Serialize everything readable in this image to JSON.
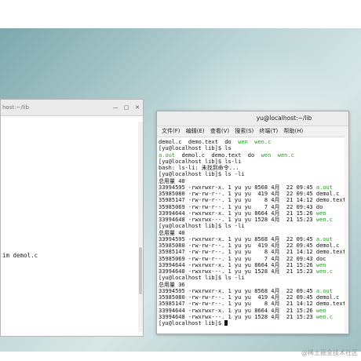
{
  "left_window": {
    "title": "host:~/lib",
    "visible_text": "im demol.c"
  },
  "terminal": {
    "title": "yu@localhost:~/lib",
    "menu": [
      "文件(F)",
      "编辑(E)",
      "查看(V)",
      "搜索(S)",
      "终端(T)",
      "帮助(H)"
    ],
    "lines": [
      [
        {
          "t": "demol.c  demo.text  do  "
        },
        {
          "t": "wen  wen.c",
          "c": "g"
        }
      ],
      [
        {
          "t": "[yu@localhost lib]$ ls"
        }
      ],
      [
        {
          "t": "a.out",
          "c": "g"
        },
        {
          "t": "  demol.c  demo.text  do  "
        },
        {
          "t": "wen  wen.c",
          "c": "g"
        }
      ],
      [
        {
          "t": "[yu@localhost lib]$ ls-li"
        }
      ],
      [
        {
          "t": "bash: ls-li: 未找到命令..."
        }
      ],
      [
        {
          "t": "[yu@localhost lib]$ ls -li"
        }
      ],
      [
        {
          "t": "总用量 40"
        }
      ],
      [
        {
          "t": "33994595 -rwxrwxr-x. 1 yu yu 8568 4月  22 09:45 "
        },
        {
          "t": "a.out",
          "c": "g"
        }
      ],
      [
        {
          "t": "35985080 -rw-rw-r--. 1 yu yu  419 4月  22 09:45 demol.c"
        }
      ],
      [
        {
          "t": "35985147 -rw-rw-r--. 1 yu yu    8 4月  21 14:12 demo.text"
        }
      ],
      [
        {
          "t": "35985069 -rw-rw-r--. 1 yu yu    7 4月  22 09:43 do"
        }
      ],
      [
        {
          "t": "33994644 -rwxrwxr-x. 1 yu yu 8664 4月  21 15:26 "
        },
        {
          "t": "wen",
          "c": "g"
        }
      ],
      [
        {
          "t": "33994648 -rwxrwx---. 1 yu yu 1528 4月  21 15:23 "
        },
        {
          "t": "wen.c",
          "c": "g"
        }
      ],
      [
        {
          "t": "[yu@localhost lib]$ ls -li"
        }
      ],
      [
        {
          "t": "总用量 40"
        }
      ],
      [
        {
          "t": "33994595 -rwxrwxr-x. 1 yu yu 8568 4月  22 09:45 "
        },
        {
          "t": "a.out",
          "c": "g"
        }
      ],
      [
        {
          "t": "35985080 -rw-rw-r--. 1 yu yu  419 4月  22 09:45 demol.c"
        }
      ],
      [
        {
          "t": "35985147 -rw-rw-r--. 1 yu yu    8 4月  21 14:12 demo.text"
        }
      ],
      [
        {
          "t": "35985069 -rw-rw-r--. 1 yu yu    7 4月  22 09:43 doc"
        }
      ],
      [
        {
          "t": "33994644 -rwxrwxr-x. 1 yu yu 8664 4月  21 15:26 "
        },
        {
          "t": "wen",
          "c": "g"
        }
      ],
      [
        {
          "t": "33994648 -rwxrwx---. 1 yu yu 1528 4月  21 15:23 "
        },
        {
          "t": "wen.c",
          "c": "g"
        }
      ],
      [
        {
          "t": "[yu@localhost lib]$ ls -li"
        }
      ],
      [
        {
          "t": "总用量 36"
        }
      ],
      [
        {
          "t": "33994595 -rwxrwxr-x. 1 yu yu 8568 4月  22 09:45 "
        },
        {
          "t": "a.out",
          "c": "g"
        }
      ],
      [
        {
          "t": "35985080 -rw-rw-r--. 1 yu yu  419 4月  22 09:45 demol.c"
        }
      ],
      [
        {
          "t": "35985147 -rw-rw-r--. 1 yu yu    8 4月  21 14:12 demo.text"
        }
      ],
      [
        {
          "t": "33994644 -rwxrwxr-x. 1 yu yu 8664 4月  21 15:26 "
        },
        {
          "t": "wen",
          "c": "g"
        }
      ],
      [
        {
          "t": "33994648 -rwxrwx---. 1 yu yu 1528 4月  21 15:23 "
        },
        {
          "t": "wen.c",
          "c": "g"
        }
      ],
      [
        {
          "t": "[yu@localhost lib]$ "
        }
      ]
    ]
  },
  "watermark": "@稀土掘金技术社区",
  "icons": {
    "minimize": "minimize-icon",
    "maximize": "maximize-icon",
    "close": "close-icon"
  },
  "colors": {
    "exec_green": "#22a022",
    "desktop": "#9fc0c2"
  }
}
